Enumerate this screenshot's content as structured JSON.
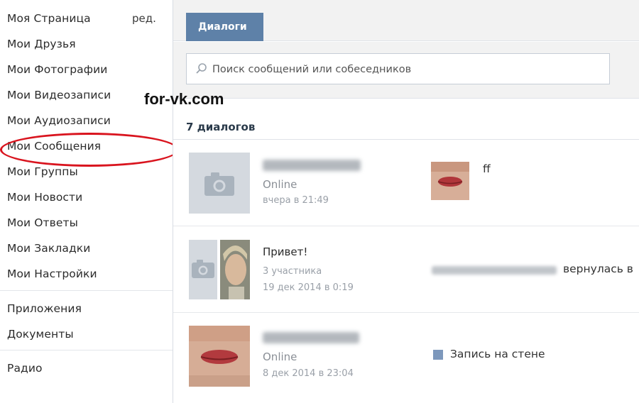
{
  "sidebar": {
    "items": [
      {
        "label": "Моя Страница"
      },
      {
        "label": "Мои Друзья"
      },
      {
        "label": "Мои Фотографии"
      },
      {
        "label": "Мои Видеозаписи"
      },
      {
        "label": "Мои Аудиозаписи"
      },
      {
        "label": "Мои Сообщения"
      },
      {
        "label": "Мои Группы"
      },
      {
        "label": "Мои Новости"
      },
      {
        "label": "Мои Ответы"
      },
      {
        "label": "Мои Закладки"
      },
      {
        "label": "Мои Настройки"
      }
    ],
    "edit_label": "ред.",
    "extra": [
      {
        "label": "Приложения"
      },
      {
        "label": "Документы"
      },
      {
        "label": "Радио"
      }
    ],
    "highlighted": "Мои Сообщения"
  },
  "watermark": "for-vk.com",
  "main": {
    "tab_label": "Диалоги",
    "search_placeholder": "Поиск сообщений или собеседников",
    "dialog_count": "7 диалогов",
    "dialogs": [
      {
        "status": "Online",
        "time": "вчера в 21:49",
        "message": "ff"
      },
      {
        "title": "Привет!",
        "members": "3 участника",
        "time": "19 дек 2014 в 0:19",
        "message": "вернулась в"
      },
      {
        "status": "Online",
        "time": "8 дек 2014 в 23:04",
        "message": "Запись на стене"
      }
    ]
  },
  "colors": {
    "tab": "#5e81a8",
    "highlight_circle": "#d9141e",
    "panel_bg": "#f2f2f2"
  }
}
